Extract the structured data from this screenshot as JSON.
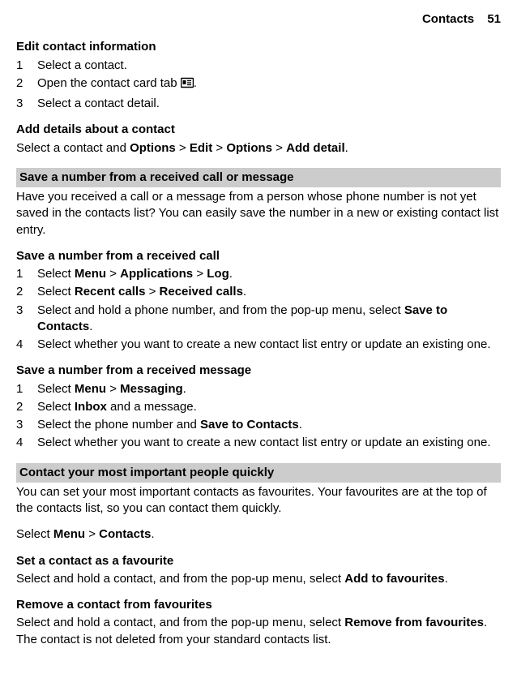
{
  "header": {
    "chapter": "Contacts",
    "page": "51"
  },
  "s1": {
    "title": "Edit contact information",
    "steps": [
      "Select a contact.",
      {
        "before": "Open the contact card tab ",
        "iconName": "contact-card-icon",
        "after": "."
      },
      "Select a contact detail."
    ]
  },
  "s2": {
    "title": "Add details about a contact",
    "line": {
      "t0": "Select a contact and ",
      "b0": "Options",
      "sep": " > ",
      "b1": "Edit",
      "b2": "Options",
      "b3": "Add detail",
      "end": "."
    }
  },
  "s3": {
    "title": "Save a number from a received call or message",
    "intro": "Have you received a call or a message from a person whose phone number is not yet saved in the contacts list? You can easily save the number in a new or existing contact list entry."
  },
  "s4": {
    "title": "Save a number from a received call",
    "step1": {
      "t0": "Select ",
      "b0": "Menu",
      "sep": " > ",
      "b1": "Applications",
      "b2": "Log",
      "end": "."
    },
    "step2": {
      "t0": "Select ",
      "b0": "Recent calls",
      "sep": " > ",
      "b1": "Received calls",
      "end": "."
    },
    "step3": {
      "t0": "Select and hold a phone number, and from the pop-up menu, select ",
      "b0": "Save to Contacts",
      "end": "."
    },
    "step4": "Select whether you want to create a new contact list entry or update an existing one."
  },
  "s5": {
    "title": "Save a number from a received message",
    "step1": {
      "t0": "Select ",
      "b0": "Menu",
      "sep": " > ",
      "b1": "Messaging",
      "end": "."
    },
    "step2": {
      "t0": "Select ",
      "b0": "Inbox",
      "t1": " and a message."
    },
    "step3": {
      "t0": "Select the phone number and ",
      "b0": "Save to Contacts",
      "end": "."
    },
    "step4": "Select whether you want to create a new contact list entry or update an existing one."
  },
  "s6": {
    "title": "Contact your most important people quickly",
    "intro": "You can set your most important contacts as favourites. Your favourites are at the top of the contacts list, so you can contact them quickly.",
    "select": {
      "t0": "Select ",
      "b0": "Menu",
      "sep": " > ",
      "b1": "Contacts",
      "end": "."
    }
  },
  "s7": {
    "title": "Set a contact as a favourite",
    "line": {
      "t0": "Select and hold a contact, and from the pop-up menu, select ",
      "b0": "Add to favourites",
      "end": "."
    }
  },
  "s8": {
    "title": "Remove a contact from favourites",
    "line": {
      "t0": "Select and hold a contact, and from the pop-up menu, select ",
      "b0": "Remove from favourites",
      "t1": ". The contact is not deleted from your standard contacts list."
    }
  }
}
